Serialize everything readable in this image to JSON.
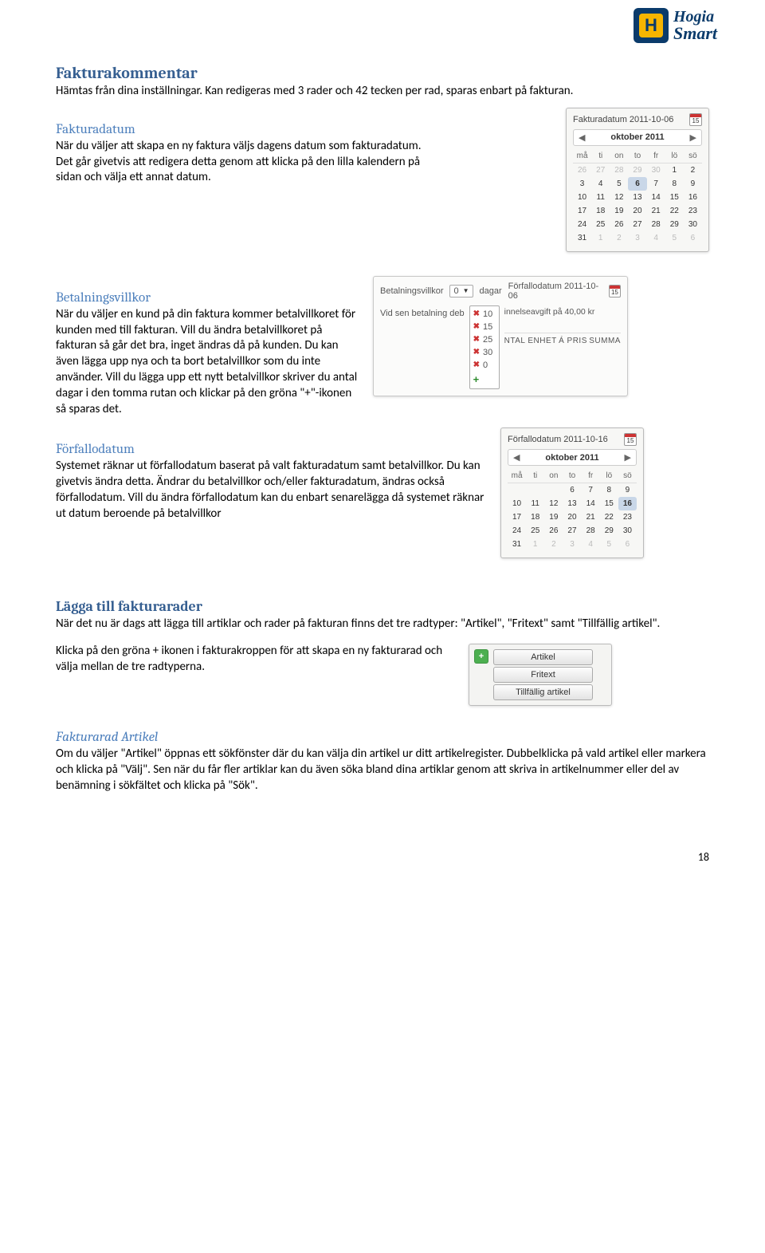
{
  "logo": {
    "brand_top": "Hogia",
    "brand_bottom": "Smart",
    "letter": "H"
  },
  "page_number": "18",
  "sec1": {
    "heading": "Fakturakommentar",
    "body": "Hämtas från dina inställningar. Kan redigeras med 3 rader och 42 tecken per rad, sparas enbart på fakturan."
  },
  "sec2": {
    "heading": "Fakturadatum",
    "body": "När du väljer att skapa en ny faktura väljs dagens datum som fakturadatum. Det går givetvis att redigera detta genom att klicka på den lilla kalendern på sidan och välja ett annat datum."
  },
  "sec3": {
    "heading": "Betalningsvillkor",
    "body": "När du väljer en kund på din faktura kommer betalvillkoret för kunden med till fakturan. Vill du ändra betalvillkoret på fakturan så går det bra, inget ändras då på kunden. Du kan även lägga upp nya och ta bort betalvillkor som du inte använder. Vill du lägga upp ett nytt betalvillkor skriver du antal dagar i den tomma rutan och klickar på den gröna \"+\"-ikonen så sparas det."
  },
  "sec4": {
    "heading": "Förfallodatum",
    "body": "Systemet räknar ut förfallodatum baserat på valt fakturadatum samt betalvillkor. Du kan givetvis ändra detta. Ändrar du betalvillkor och/eller fakturadatum, ändras också förfallodatum. Vill du ändra förfallodatum kan du enbart senarelägga då systemet räknar ut datum beroende på betalvillkor"
  },
  "sec5": {
    "heading": "Lägga till fakturarader",
    "body1": "När det nu är dags att lägga till artiklar och rader på fakturan finns det tre radtyper: \"Artikel\", \"Fritext\" samt \"Tillfällig artikel\".",
    "body2": "Klicka på den gröna + ikonen i fakturakroppen för att skapa en ny fakturarad och välja mellan de tre radtyperna."
  },
  "sec6": {
    "heading": "Fakturarad Artikel",
    "body": "Om du väljer \"Artikel\" öppnas ett sökfönster där du kan välja din artikel ur ditt artikelregister. Dubbelklicka på vald artikel eller markera och klicka på \"Välj\". Sen när du får fler artiklar kan du även söka bland dina artiklar genom att skriva in artikelnummer eller del av benämning i sökfältet och klicka på \"Sök\"."
  },
  "cal1": {
    "label": "Fakturadatum 2011-10-06",
    "month": "oktober 2011",
    "dow": [
      "må",
      "ti",
      "on",
      "to",
      "fr",
      "lö",
      "sö"
    ],
    "rows": [
      {
        "d": [
          26,
          27,
          28,
          29,
          30,
          1,
          2
        ],
        "dim": [
          1,
          1,
          1,
          1,
          1,
          0,
          0
        ]
      },
      {
        "d": [
          3,
          4,
          5,
          6,
          7,
          8,
          9
        ],
        "sel": 6
      },
      {
        "d": [
          10,
          11,
          12,
          13,
          14,
          15,
          16
        ]
      },
      {
        "d": [
          17,
          18,
          19,
          20,
          21,
          22,
          23
        ]
      },
      {
        "d": [
          24,
          25,
          26,
          27,
          28,
          29,
          30
        ]
      },
      {
        "d": [
          31,
          1,
          2,
          3,
          4,
          5,
          6
        ],
        "dim": [
          0,
          1,
          1,
          1,
          1,
          1,
          1
        ]
      }
    ]
  },
  "cal2": {
    "label": "Förfallodatum 2011-10-16",
    "month": "oktober 2011",
    "dow": [
      "må",
      "ti",
      "on",
      "to",
      "fr",
      "lö",
      "sö"
    ],
    "rows": [
      {
        "d": [
          "",
          "",
          "",
          "",
          6,
          7,
          8,
          9
        ]
      },
      {
        "d": [
          10,
          11,
          12,
          13,
          14,
          15,
          16
        ],
        "sel": 16
      },
      {
        "d": [
          17,
          18,
          19,
          20,
          21,
          22,
          23
        ]
      },
      {
        "d": [
          24,
          25,
          26,
          27,
          28,
          29,
          30
        ]
      },
      {
        "d": [
          31,
          1,
          2,
          3,
          4,
          5,
          6
        ],
        "dim": [
          0,
          1,
          1,
          1,
          1,
          1,
          1
        ]
      }
    ]
  },
  "bv": {
    "label": "Betalningsvillkor",
    "selected": "0",
    "unit": "dagar",
    "due_label": "Förfallodatum 2011-10-06",
    "late_label": "Vid sen betalning deb",
    "fee_text": "innelseavgift på 40,00 kr",
    "options": [
      "10",
      "15",
      "25",
      "30",
      "0"
    ],
    "cols": {
      "left": "NTAL  ENHET",
      "mid": "Á PRIS",
      "right": "SUMMA"
    }
  },
  "rowtype": {
    "plus": "+",
    "items": [
      "Artikel",
      "Fritext",
      "Tillfällig artikel"
    ]
  }
}
